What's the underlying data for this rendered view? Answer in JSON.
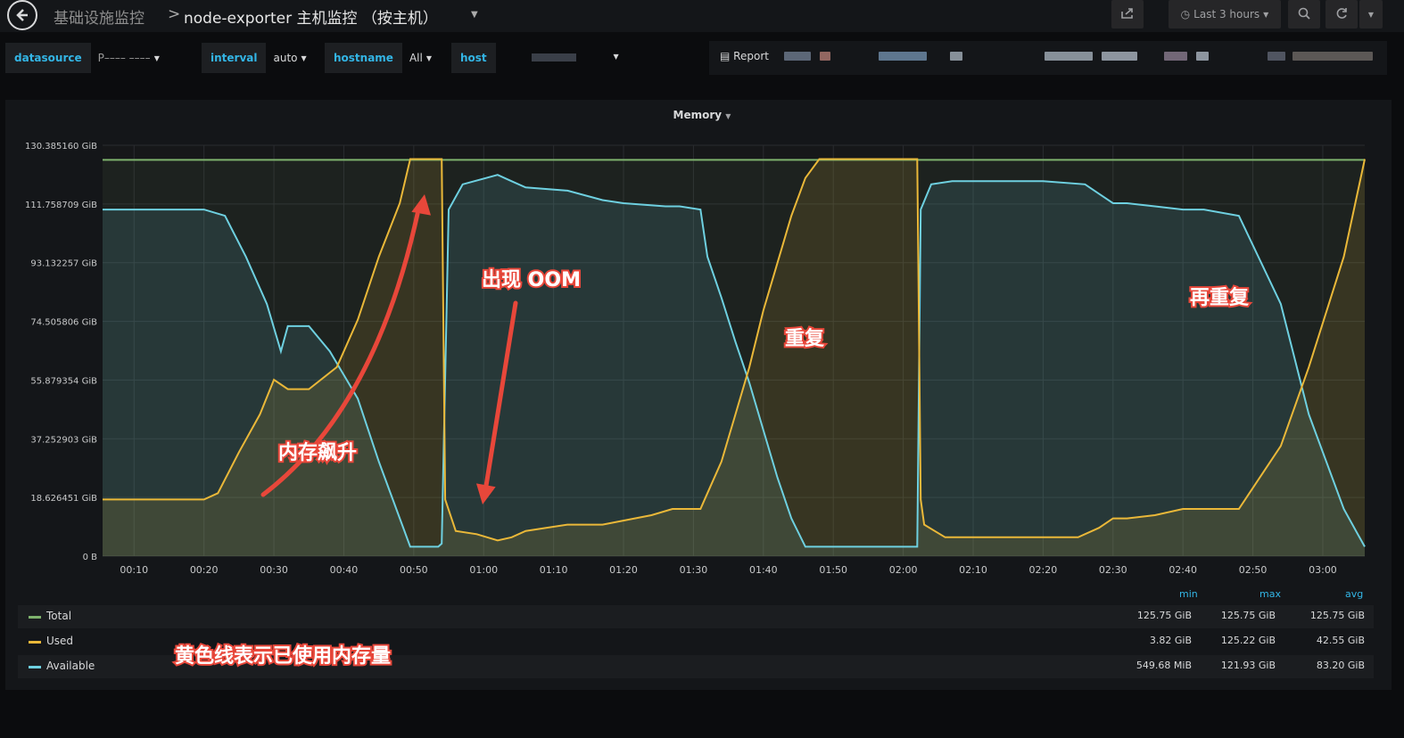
{
  "header": {
    "folder": "基础设施监控",
    "separator": ">",
    "title": "node-exporter 主机监控 （按主机）",
    "time_range": "Last 3 hours"
  },
  "variables": [
    {
      "label": "datasource",
      "value": "P–––– ––––"
    },
    {
      "label": "interval",
      "value": "auto"
    },
    {
      "label": "hostname",
      "value": "All"
    },
    {
      "label": "host",
      "value": ""
    }
  ],
  "report": {
    "label": "Report"
  },
  "panel": {
    "title": "Memory"
  },
  "colors": {
    "total": "#7eb26d",
    "used": "#eab839",
    "available": "#6ed0e0",
    "accent": "#33b5e5",
    "annotation": "#e8473a"
  },
  "chart_data": {
    "type": "area",
    "title": "Memory",
    "y_ticks": [
      "130.385160 GiB",
      "111.758709 GiB",
      "93.132257 GiB",
      "74.505806 GiB",
      "55.879354 GiB",
      "37.252903 GiB",
      "18.626451 GiB",
      "0 B"
    ],
    "x_ticks": [
      "00:10",
      "00:20",
      "00:30",
      "00:40",
      "00:50",
      "01:00",
      "01:10",
      "01:20",
      "01:30",
      "01:40",
      "01:50",
      "02:00",
      "02:10",
      "02:20",
      "02:30",
      "02:40",
      "02:50",
      "03:00"
    ],
    "ylim_gib": [
      0,
      130.38516
    ],
    "x_range_min": [
      5.5,
      186
    ],
    "grid": true,
    "series": [
      {
        "name": "Total",
        "color": "#7eb26d",
        "x": [
          5.5,
          186
        ],
        "y": [
          125.75,
          125.75
        ]
      },
      {
        "name": "Used",
        "color": "#eab839",
        "x": [
          5.5,
          20,
          22,
          25,
          28,
          30,
          32,
          35,
          39,
          42,
          45,
          48,
          49.5,
          53.5,
          54,
          54.5,
          56,
          59,
          62,
          64,
          66,
          72,
          77,
          84,
          87,
          88,
          91,
          92,
          94,
          96,
          98,
          100,
          102,
          104,
          106,
          108,
          110,
          112,
          114,
          116,
          122,
          122.5,
          123,
          126,
          135,
          140,
          145,
          148,
          150,
          152,
          156,
          160,
          163,
          168,
          174,
          178,
          183,
          186
        ],
        "y": [
          18,
          18,
          20,
          33,
          45,
          56,
          53,
          53,
          60,
          75,
          95,
          112,
          126,
          126,
          126,
          18,
          8,
          7,
          5,
          6,
          8,
          10,
          10,
          13,
          15,
          15,
          15,
          20,
          30,
          45,
          60,
          78,
          93,
          108,
          120,
          126,
          126,
          126,
          126,
          126,
          126,
          18,
          10,
          6,
          6,
          6,
          6,
          9,
          12,
          12,
          13,
          15,
          15,
          15,
          35,
          60,
          95,
          126
        ]
      },
      {
        "name": "Available",
        "color": "#6ed0e0",
        "x": [
          5.5,
          20,
          23,
          26,
          29,
          31,
          32,
          35,
          38,
          42,
          45,
          48,
          49.5,
          53.5,
          54,
          55,
          57,
          62,
          64,
          66,
          72,
          77,
          80,
          86,
          88,
          91,
          92,
          94,
          96,
          98,
          100,
          102,
          104,
          106,
          108,
          110,
          112,
          114,
          116,
          122,
          122.5,
          124,
          127,
          135,
          140,
          146,
          148,
          150,
          152,
          156,
          160,
          163,
          168,
          174,
          178,
          183,
          186
        ],
        "y": [
          110,
          110,
          108,
          95,
          80,
          65,
          73,
          73,
          65,
          50,
          30,
          12,
          3,
          3,
          4,
          110,
          118,
          121,
          119,
          117,
          116,
          113,
          112,
          111,
          111,
          110,
          95,
          82,
          68,
          55,
          40,
          25,
          12,
          3,
          3,
          3,
          3,
          3,
          3,
          3,
          110,
          118,
          119,
          119,
          119,
          118,
          115,
          112,
          112,
          111,
          110,
          110,
          108,
          80,
          45,
          15,
          3
        ]
      }
    ]
  },
  "legend": {
    "headers": {
      "min": "min",
      "max": "max",
      "avg": "avg"
    },
    "rows": [
      {
        "name": "Total",
        "color": "#7eb26d",
        "min": "125.75 GiB",
        "max": "125.75 GiB",
        "avg": "125.75 GiB"
      },
      {
        "name": "Used",
        "color": "#eab839",
        "min": "3.82 GiB",
        "max": "125.22 GiB",
        "avg": "42.55 GiB"
      },
      {
        "name": "Available",
        "color": "#6ed0e0",
        "min": "549.68 MiB",
        "max": "121.93 GiB",
        "avg": "83.20 GiB"
      }
    ]
  },
  "annotations": {
    "memory_surge": "内存飙升",
    "oom": "出现 OOM",
    "repeat": "重复",
    "repeat_again": "再重复",
    "used_note": "黄色线表示已使用内存量"
  }
}
